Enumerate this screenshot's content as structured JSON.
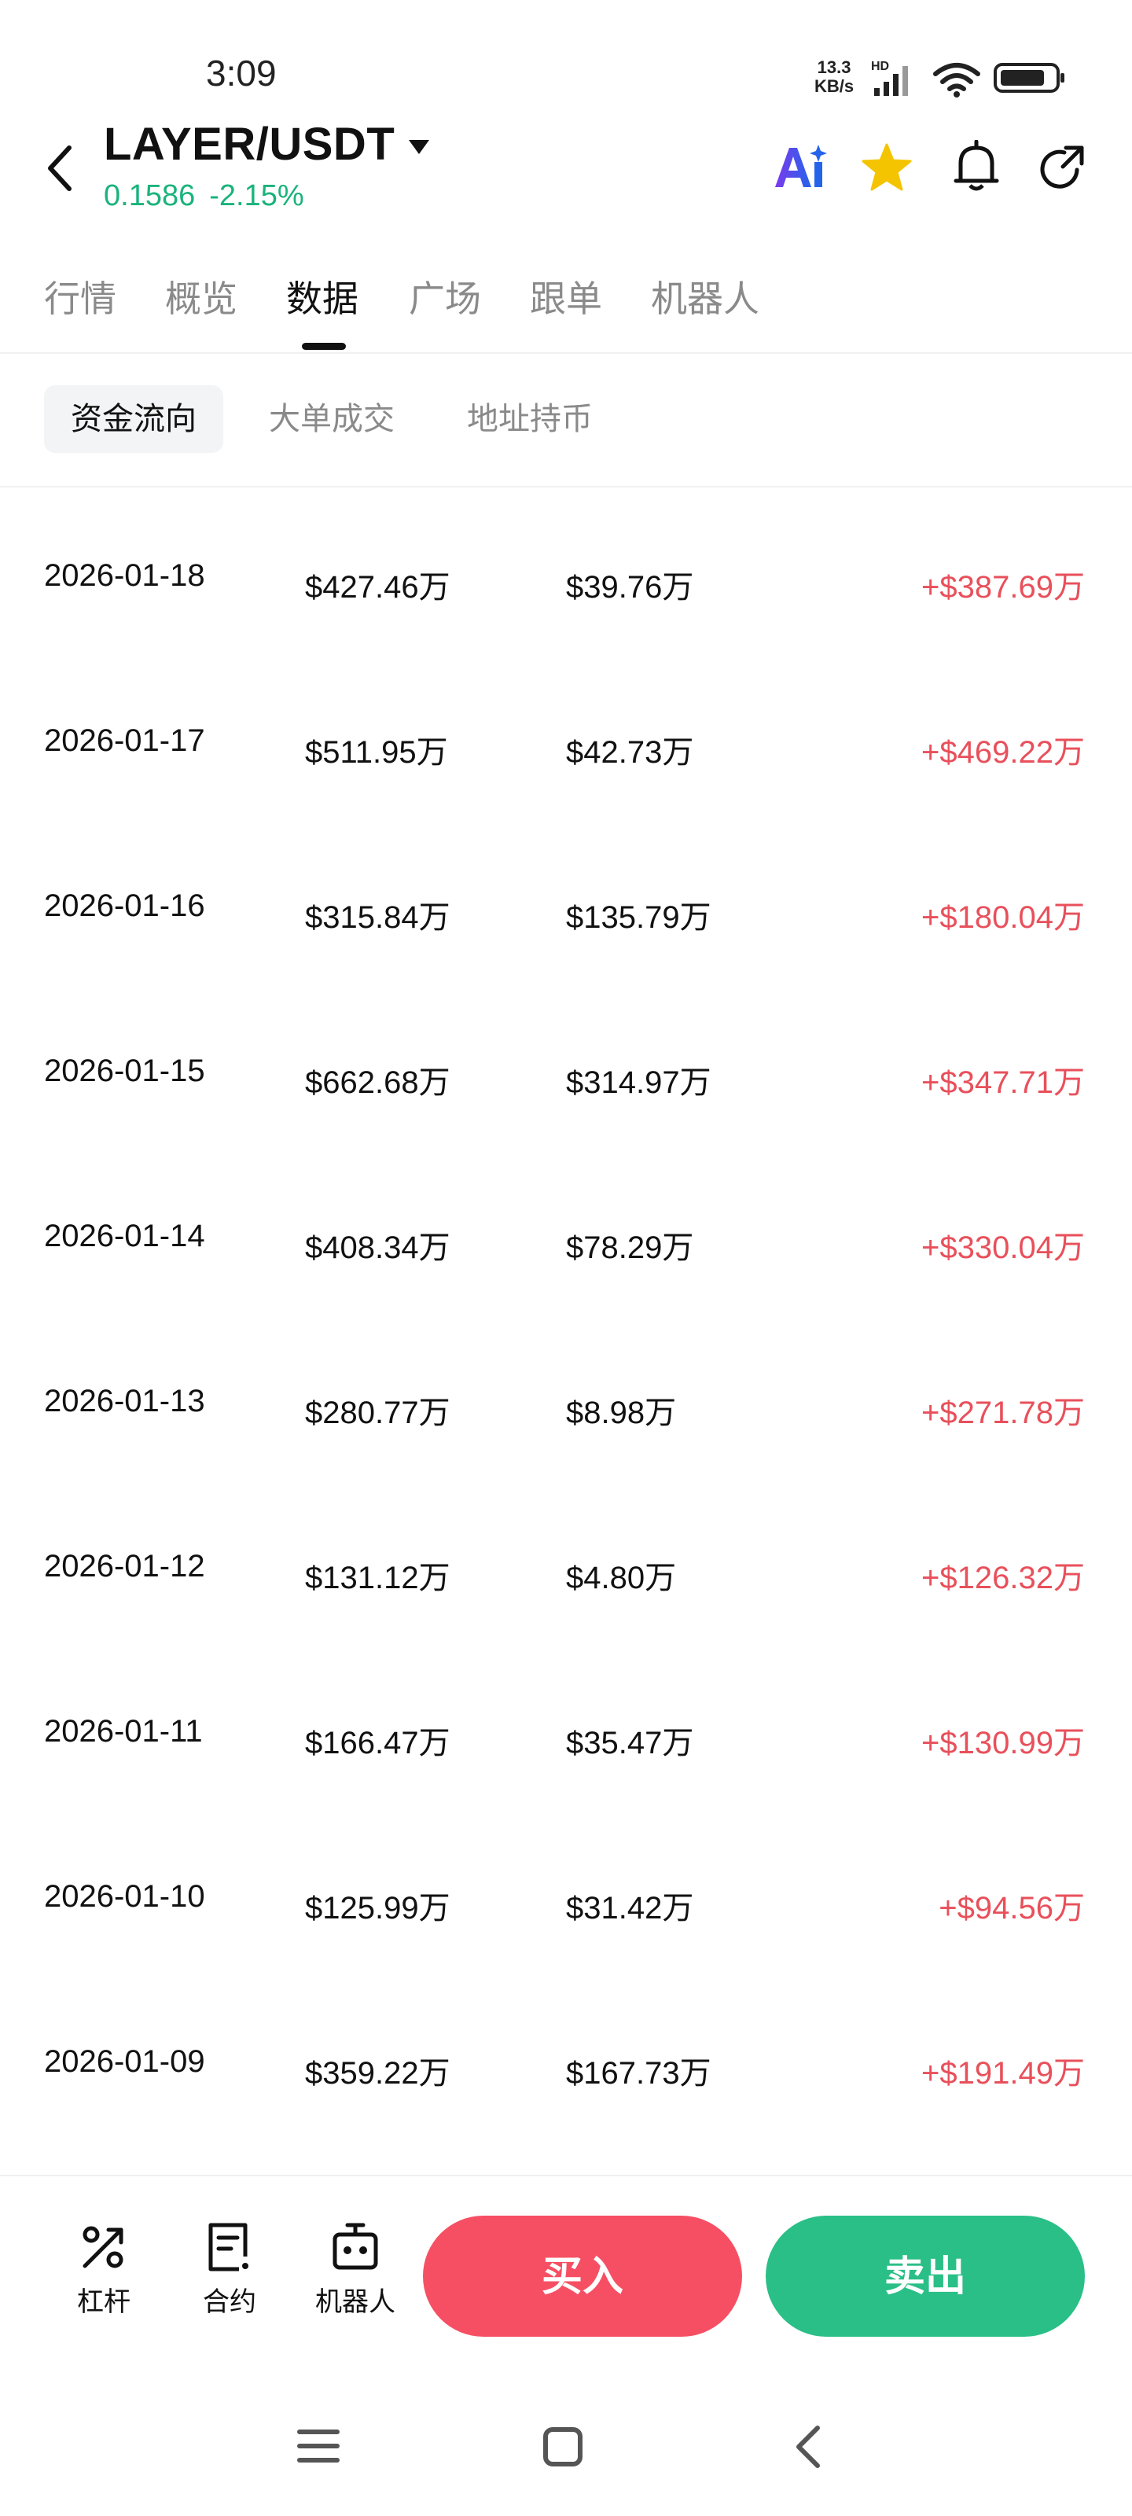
{
  "status_bar": {
    "time": "3:09",
    "net_speed_value": "13.3",
    "net_speed_unit": "KB/s",
    "signal_badge": "HD",
    "icons": [
      "signal-icon",
      "wifi-icon",
      "battery-icon"
    ]
  },
  "header": {
    "pair": "LAYER/USDT",
    "price": "0.1586",
    "change": "-2.15%",
    "icons": [
      "back-icon",
      "dropdown-caret-icon",
      "ai-icon",
      "star-icon",
      "bell-icon",
      "share-icon"
    ]
  },
  "tabs": [
    "行情",
    "概览",
    "数据",
    "广场",
    "跟单",
    "机器人"
  ],
  "active_tab": "数据",
  "sub_tabs": [
    "资金流向",
    "大单成交",
    "地址持币"
  ],
  "active_sub_tab": "资金流向",
  "rows": [
    {
      "date": "2026-01-18",
      "inflow": "$427.46万",
      "outflow": "$39.76万",
      "net": "+$387.69万"
    },
    {
      "date": "2026-01-17",
      "inflow": "$511.95万",
      "outflow": "$42.73万",
      "net": "+$469.22万"
    },
    {
      "date": "2026-01-16",
      "inflow": "$315.84万",
      "outflow": "$135.79万",
      "net": "+$180.04万"
    },
    {
      "date": "2026-01-15",
      "inflow": "$662.68万",
      "outflow": "$314.97万",
      "net": "+$347.71万"
    },
    {
      "date": "2026-01-14",
      "inflow": "$408.34万",
      "outflow": "$78.29万",
      "net": "+$330.04万"
    },
    {
      "date": "2026-01-13",
      "inflow": "$280.77万",
      "outflow": "$8.98万",
      "net": "+$271.78万"
    },
    {
      "date": "2026-01-12",
      "inflow": "$131.12万",
      "outflow": "$4.80万",
      "net": "+$126.32万"
    },
    {
      "date": "2026-01-11",
      "inflow": "$166.47万",
      "outflow": "$35.47万",
      "net": "+$130.99万"
    },
    {
      "date": "2026-01-10",
      "inflow": "$125.99万",
      "outflow": "$31.42万",
      "net": "+$94.56万"
    },
    {
      "date": "2026-01-09",
      "inflow": "$359.22万",
      "outflow": "$167.73万",
      "net": "+$191.49万"
    }
  ],
  "bottom_bar": {
    "items": [
      {
        "label": "杠杆",
        "icon": "leverage-icon"
      },
      {
        "label": "合约",
        "icon": "contract-icon"
      },
      {
        "label": "机器人",
        "icon": "robot-icon"
      }
    ],
    "buy_label": "买入",
    "sell_label": "卖出"
  },
  "nav_bar": {
    "icons": [
      "menu-icon",
      "home-icon",
      "back-nav-icon"
    ]
  },
  "colors": {
    "price_up_green": "#1ab37c",
    "net_inflow_red": "#e8505b",
    "buy_button": "#f64f63",
    "sell_button": "#2abf87",
    "ai_gradient_start": "#7c3aed",
    "ai_gradient_end": "#2563eb",
    "star": "#f5c400"
  }
}
